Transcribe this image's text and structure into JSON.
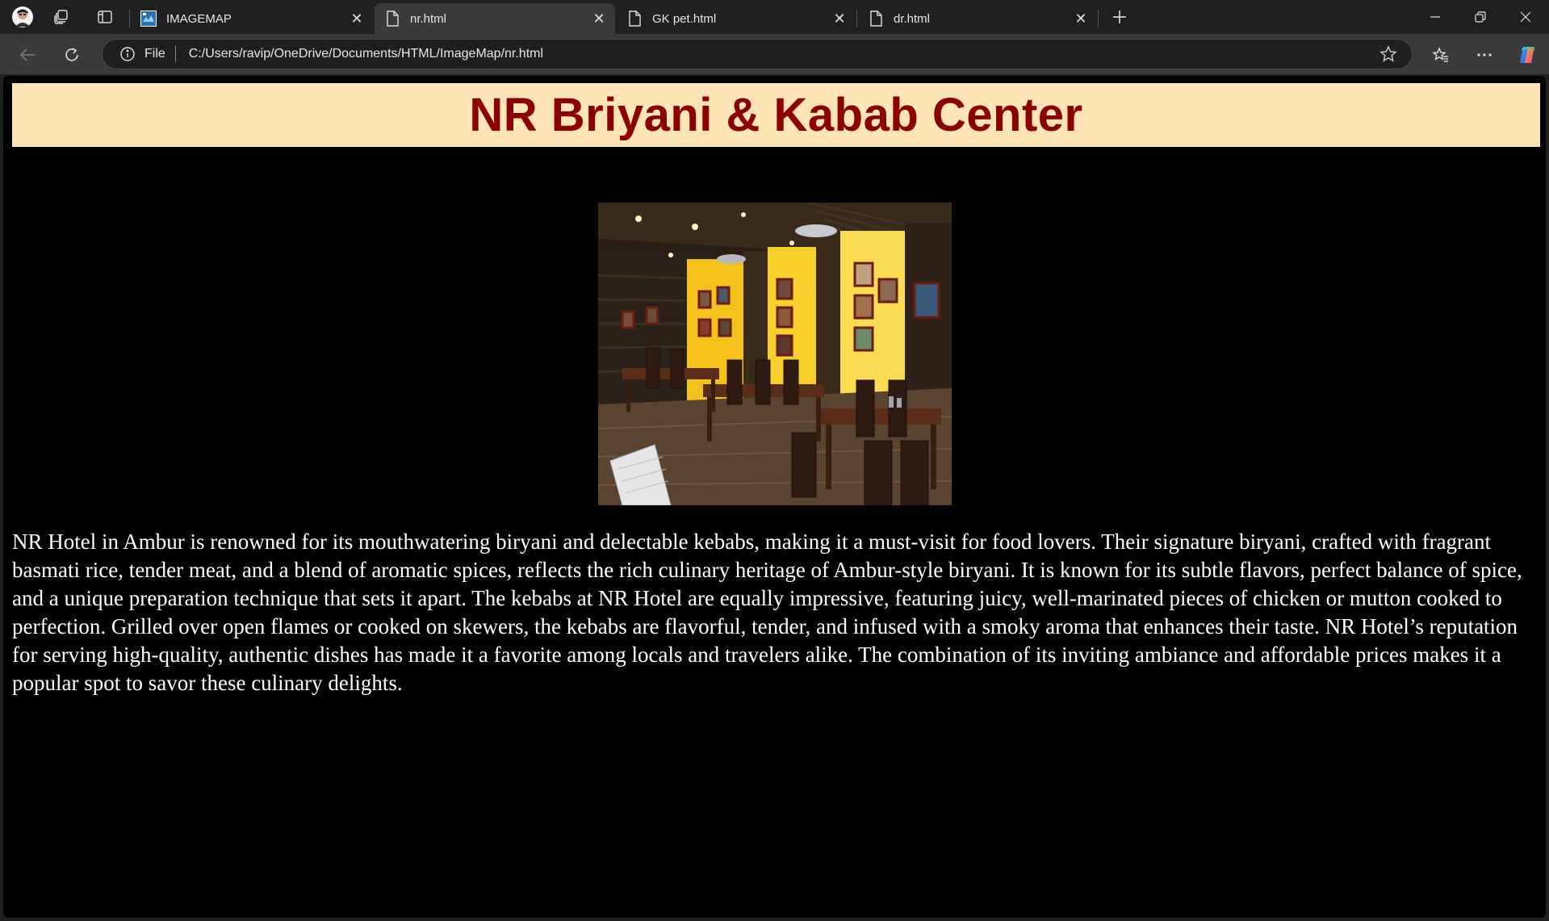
{
  "browser": {
    "tabs": [
      {
        "label": "IMAGEMAP",
        "favicon": "image-map-favicon",
        "active": false
      },
      {
        "label": "nr.html",
        "favicon": "file-icon",
        "active": true
      },
      {
        "label": "GK pet.html",
        "favicon": "file-icon",
        "active": false
      },
      {
        "label": "dr.html",
        "favicon": "file-icon",
        "active": false
      }
    ],
    "address": {
      "scheme_label": "File",
      "url": "C:/Users/ravip/OneDrive/Documents/HTML/ImageMap/nr.html"
    },
    "icons": {
      "profile": "profile-avatar-icon",
      "workspaces": "workspaces-icon",
      "tab_actions": "tab-actions-icon",
      "new_tab": "plus-icon",
      "minimize": "minimize-icon",
      "restore": "restore-icon",
      "close": "close-icon",
      "back": "back-arrow-icon",
      "refresh": "refresh-icon",
      "info": "info-icon",
      "favorite": "star-icon",
      "favorites": "favorites-icon",
      "more": "more-icon",
      "copilot": "copilot-icon"
    }
  },
  "page": {
    "title": "NR Briyani & Kabab Center",
    "colors": {
      "banner_bg": "#ffe4b5",
      "title": "#8b0000",
      "body_bg": "#000000",
      "text": "#ffffff"
    },
    "image": {
      "subject": "restaurant dining hall interior with yellow walls, wooden tables and chairs, framed portraits"
    },
    "description": "NR Hotel in Ambur is renowned for its mouthwatering biryani and delectable kebabs, making it a must-visit for food lovers. Their signature biryani, crafted with fragrant basmati rice, tender meat, and a blend of aromatic spices, reflects the rich culinary heritage of Ambur-style biryani. It is known for its subtle flavors, perfect balance of spice, and a unique preparation technique that sets it apart. The kebabs at NR Hotel are equally impressive, featuring juicy, well-marinated pieces of chicken or mutton cooked to perfection. Grilled over open flames or cooked on skewers, the kebabs are flavorful, tender, and infused with a smoky aroma that enhances their taste. NR Hotel’s reputation for serving high-quality, authentic dishes has made it a favorite among locals and travelers alike. The combination of its inviting ambiance and affordable prices makes it a popular spot to savor these culinary delights."
  }
}
